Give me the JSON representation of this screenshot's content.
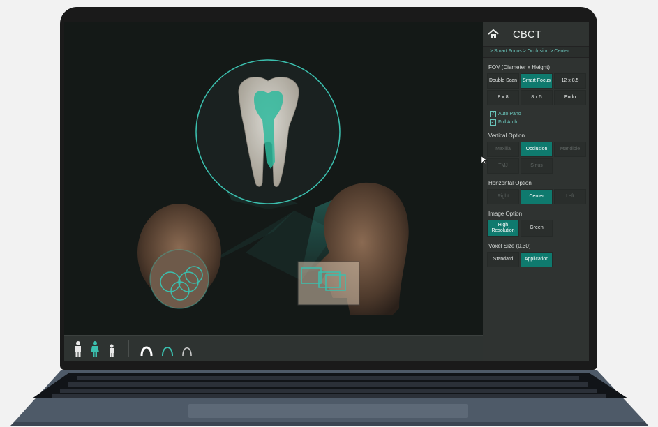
{
  "panel": {
    "title": "CBCT",
    "breadcrumb": "> Smart Focus > Occlusion > Center",
    "fov": {
      "title": "FOV (Diameter x Height)",
      "options": [
        {
          "label": "Double Scan",
          "state": "normal"
        },
        {
          "label": "Smart Focus",
          "state": "active"
        },
        {
          "label": "12 x 8.5",
          "state": "normal"
        },
        {
          "label": "8 x 8",
          "state": "normal"
        },
        {
          "label": "8 x 5",
          "state": "normal"
        },
        {
          "label": "Endo",
          "state": "normal"
        }
      ],
      "checkboxes": [
        {
          "label": "Auto Pano",
          "checked": true
        },
        {
          "label": "Full Arch",
          "checked": true
        }
      ]
    },
    "vertical": {
      "title": "Vertical Option",
      "options": [
        {
          "label": "Maxilla",
          "state": "disabled"
        },
        {
          "label": "Occlusion",
          "state": "active"
        },
        {
          "label": "Mandible",
          "state": "disabled"
        },
        {
          "label": "TMJ",
          "state": "disabled"
        },
        {
          "label": "Sinus",
          "state": "disabled"
        }
      ]
    },
    "horizontal": {
      "title": "Horizontal Option",
      "options": [
        {
          "label": "Right",
          "state": "disabled"
        },
        {
          "label": "Center",
          "state": "active"
        },
        {
          "label": "Left",
          "state": "disabled"
        }
      ]
    },
    "image": {
      "title": "Image Option",
      "options": [
        {
          "label": "High Resolution",
          "state": "active"
        },
        {
          "label": "Green",
          "state": "normal"
        }
      ]
    },
    "voxel": {
      "title": "Voxel Size (0.30)",
      "options": [
        {
          "label": "Standard",
          "state": "normal"
        },
        {
          "label": "Application",
          "state": "active"
        }
      ]
    }
  },
  "bottom_bar": {
    "patient_icons": [
      "adult-male-icon",
      "adult-female-icon",
      "child-icon"
    ],
    "arch_icons": [
      "arch-large-icon",
      "arch-medium-icon",
      "arch-small-icon"
    ]
  },
  "colors": {
    "accent": "#0f7a6e",
    "teal_glow": "#3bbfae",
    "panel_bg": "#2f3331"
  }
}
